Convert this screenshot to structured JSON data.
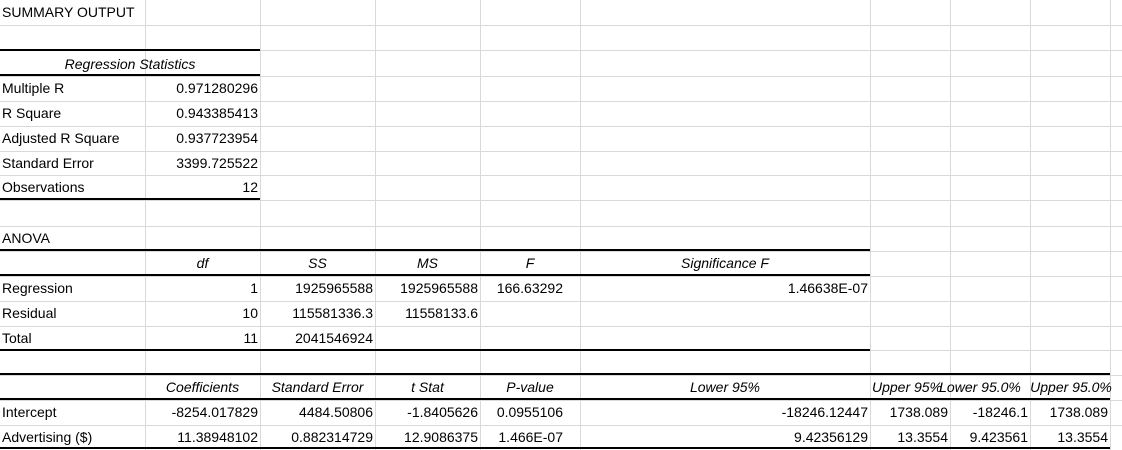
{
  "title": "SUMMARY OUTPUT",
  "regression_statistics": {
    "header": "Regression Statistics",
    "rows": [
      {
        "label": "Multiple R",
        "value": "0.971280296"
      },
      {
        "label": "R Square",
        "value": "0.943385413"
      },
      {
        "label": "Adjusted R Square",
        "value": "0.937723954"
      },
      {
        "label": "Standard Error",
        "value": "3399.725522"
      },
      {
        "label": "Observations",
        "value": "12"
      }
    ]
  },
  "anova": {
    "title": "ANOVA",
    "headers": [
      "",
      "df",
      "SS",
      "MS",
      "F",
      "Significance F"
    ],
    "rows": [
      [
        "Regression",
        "1",
        "1925965588",
        "1925965588",
        "166.63292",
        "1.46638E-07"
      ],
      [
        "Residual",
        "10",
        "115581336.3",
        "11558133.6",
        "",
        ""
      ],
      [
        "Total",
        "11",
        "2041546924",
        "",
        "",
        ""
      ]
    ]
  },
  "coefficients": {
    "headers": [
      "",
      "Coefficients",
      "Standard Error",
      "t Stat",
      "P-value",
      "Lower 95%",
      "Upper 95%",
      "Lower 95.0%",
      "Upper 95.0%"
    ],
    "rows": [
      [
        "Intercept",
        "-8254.017829",
        "4484.50806",
        "-1.8405626",
        "0.0955106",
        "-18246.12447",
        "1738.089",
        "-18246.1",
        "1738.089"
      ],
      [
        "Advertising ($)",
        "11.38948102",
        "0.882314729",
        "12.9086375",
        "1.466E-07",
        "9.42356129",
        "13.3554",
        "9.423561",
        "13.3554"
      ]
    ]
  }
}
